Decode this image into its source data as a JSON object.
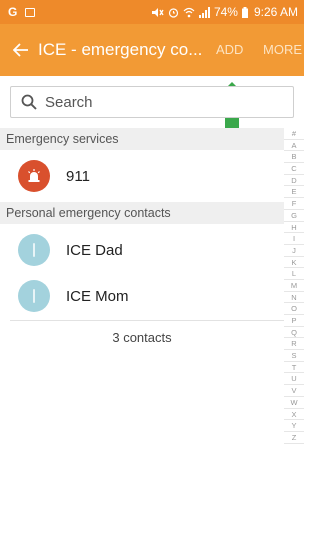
{
  "status_bar": {
    "left_icon_letter": "G",
    "battery_percent": "74%",
    "time": "9:26 AM"
  },
  "app_bar": {
    "title": "ICE - emergency co...",
    "add_label": "ADD",
    "more_label": "MORE"
  },
  "search": {
    "placeholder": "Search"
  },
  "sections": {
    "emergency_header": "Emergency services",
    "personal_header": "Personal emergency contacts"
  },
  "contacts": {
    "emergency": {
      "name": "911",
      "icon": "siren-icon"
    },
    "dad": {
      "name": "ICE Dad"
    },
    "mom": {
      "name": "ICE Mom"
    }
  },
  "footer": {
    "count_text": "3 contacts"
  },
  "alphabet_index": [
    "#",
    "A",
    "B",
    "C",
    "D",
    "E",
    "F",
    "G",
    "H",
    "I",
    "J",
    "K",
    "L",
    "M",
    "N",
    "O",
    "P",
    "Q",
    "R",
    "S",
    "T",
    "U",
    "V",
    "W",
    "X",
    "Y",
    "Z"
  ],
  "colors": {
    "app_bar": "#f29a35",
    "status_bar": "#ee8a2a",
    "annotation_arrow": "#3aa84b",
    "emergency_avatar": "#d9502d",
    "person_avatar": "#a3d2dd"
  }
}
